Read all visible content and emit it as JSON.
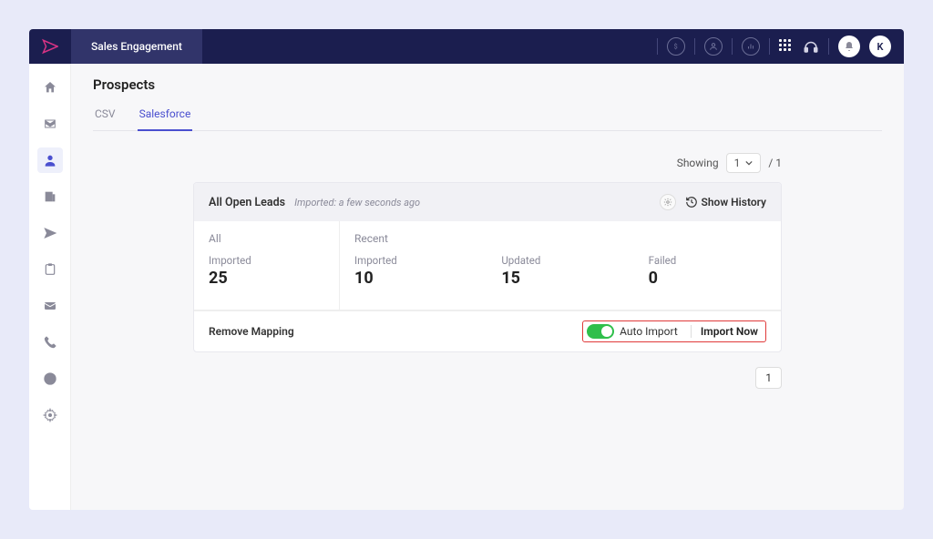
{
  "header": {
    "app_name": "Sales Engagement",
    "avatar_letter": "K"
  },
  "page": {
    "title": "Prospects",
    "tabs": [
      "CSV",
      "Salesforce"
    ],
    "active_tab": "Salesforce"
  },
  "showing": {
    "label": "Showing",
    "current": "1",
    "total": "/ 1"
  },
  "card": {
    "title": "All Open Leads",
    "subtitle": "Imported: a few seconds ago",
    "show_history": "Show History",
    "cols": {
      "all": "All",
      "recent": "Recent"
    },
    "metrics": {
      "all_imported_label": "Imported",
      "all_imported_value": "25",
      "recent_imported_label": "Imported",
      "recent_imported_value": "10",
      "updated_label": "Updated",
      "updated_value": "15",
      "failed_label": "Failed",
      "failed_value": "0"
    },
    "footer": {
      "remove_mapping": "Remove Mapping",
      "auto_import": "Auto Import",
      "import_now": "Import Now"
    }
  },
  "pagination": {
    "page": "1"
  }
}
